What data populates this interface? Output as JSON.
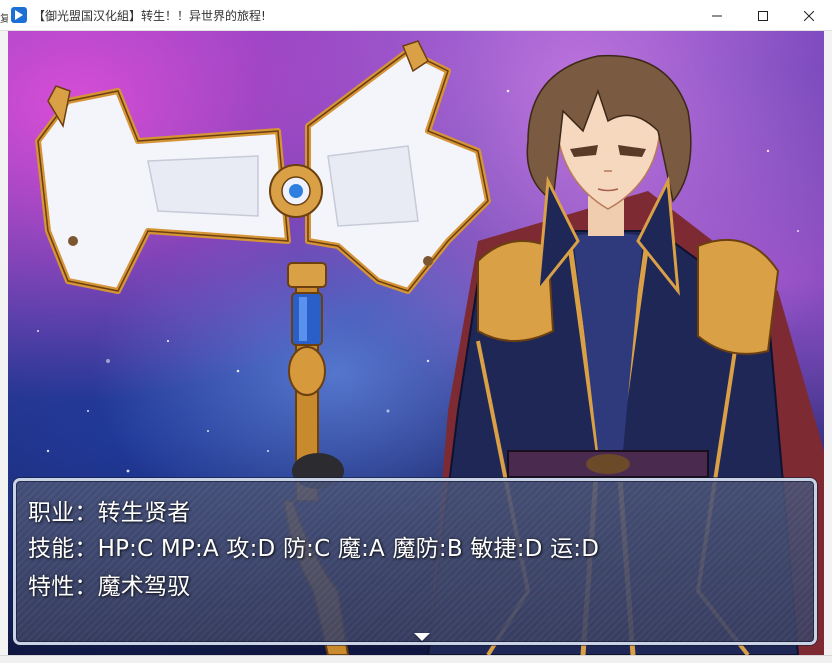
{
  "window": {
    "title": "【御光盟国汉化組】转生！！异世界的旅程!",
    "left_edge_char": "复",
    "minimize_icon": "minimize-icon",
    "maximize_icon": "maximize-icon",
    "close_icon": "close-icon"
  },
  "message": {
    "line1": "职业：转生贤者",
    "line2": "技能：HP:C MP:A 攻:D 防:C 魔:A 魔防:B 敏捷:D 运:D",
    "line3": "特性：魔术驾驭",
    "continue_icon": "down-triangle-icon"
  },
  "colors": {
    "window_border": "#c9d3e6",
    "window_fill": "#485276",
    "text": "#ffffff",
    "armor_gold": "#d9a046",
    "coat_navy": "#1f2756"
  }
}
